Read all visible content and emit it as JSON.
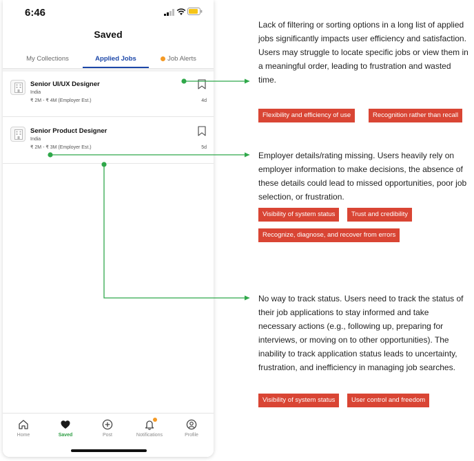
{
  "status_bar": {
    "time": "6:46"
  },
  "header": {
    "title": "Saved"
  },
  "tabs": [
    {
      "label": "My Collections"
    },
    {
      "label": "Applied Jobs"
    },
    {
      "label": "Job Alerts"
    }
  ],
  "jobs": [
    {
      "title": "Senior UI/UX Designer",
      "location": "India",
      "salary": "₹ 2M - ₹ 4M (Employer Est.)",
      "age": "4d"
    },
    {
      "title": "Senior Product Designer",
      "location": "India",
      "salary": "₹ 2M - ₹ 3M (Employer Est.)",
      "age": "5d"
    }
  ],
  "bottom_nav": [
    {
      "label": "Home",
      "icon": "home-icon"
    },
    {
      "label": "Saved",
      "icon": "heart-icon"
    },
    {
      "label": "Post",
      "icon": "plus-circle-icon"
    },
    {
      "label": "Notifications",
      "icon": "bell-icon"
    },
    {
      "label": "Profile",
      "icon": "profile-icon"
    }
  ],
  "annotations": [
    {
      "text": "Lack of filtering or sorting options in a long list of applied jobs significantly impacts user efficiency and satisfaction.",
      "text2": "Users may struggle to locate specific jobs or view them in a meaningful order, leading to frustration and wasted time.",
      "tags": [
        "Flexibility and efficiency of use",
        "Recognition rather than recall"
      ]
    },
    {
      "text": "Employer details/rating missing. Users heavily rely on employer information to make decisions, the absence of these details could lead to missed opportunities, poor job selection, or frustration.",
      "tags": [
        "Visibility of system status",
        "Trust and credibility",
        "Recognize, diagnose, and recover from errors"
      ]
    },
    {
      "text": "No way to track status. Users need to track the status of their job applications to stay informed and take necessary actions (e.g., following up, preparing for interviews, or moving on to other opportunities). The inability to track application status leads to uncertainty, frustration, and inefficiency in managing job searches.",
      "tags": [
        "Visibility of system status",
        "User control and freedom"
      ]
    }
  ],
  "colors": {
    "accent_blue": "#1b46a8",
    "tag_red": "#d94534",
    "connector_green": "#2fa84a",
    "alert_orange": "#f49a25"
  }
}
